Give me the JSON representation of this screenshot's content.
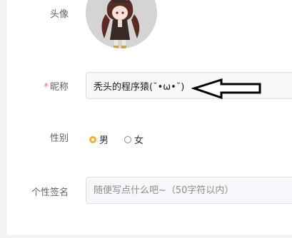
{
  "profile": {
    "avatar_label": "头像",
    "nickname": {
      "required_mark": "*",
      "label": "昵称",
      "value": "秃头的程序猿(˘•ω•˘)"
    },
    "gender": {
      "label": "性别",
      "options": [
        "男",
        "女"
      ],
      "selected": "男"
    },
    "signature": {
      "label": "个性签名",
      "placeholder": "随便写点什么吧~（50字符以内）"
    }
  },
  "colors": {
    "accent": "#f0b429",
    "required": "#f56c6c"
  }
}
